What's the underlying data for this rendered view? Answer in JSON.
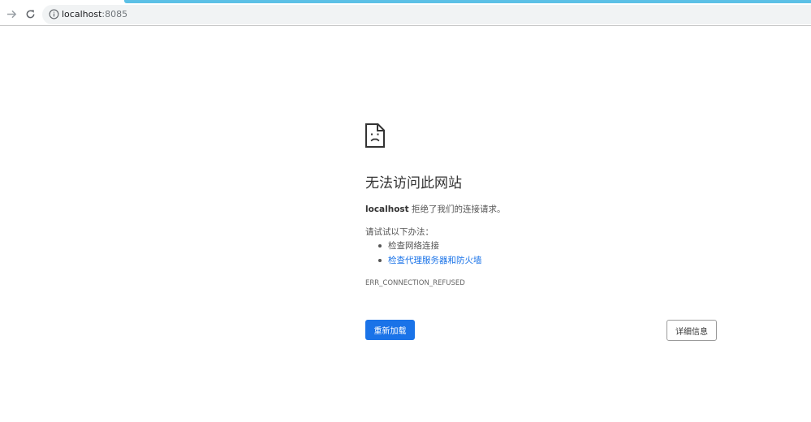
{
  "browser": {
    "url_host": "localhost",
    "url_port": ":8085"
  },
  "error_page": {
    "title": "无法访问此网站",
    "host": "localhost",
    "refused_message": " 拒绝了我们的连接请求。",
    "try_heading": "请试试以下办法：",
    "suggestions": [
      {
        "label": "检查网络连接",
        "is_link": false
      },
      {
        "label": "检查代理服务器和防火墙",
        "is_link": true
      }
    ],
    "error_code": "ERR_CONNECTION_REFUSED",
    "reload_label": "重新加载",
    "details_label": "详细信息"
  },
  "colors": {
    "primary_button": "#1a73e8",
    "link": "#1a73e8",
    "loading_bar": "#5cc0e6"
  }
}
